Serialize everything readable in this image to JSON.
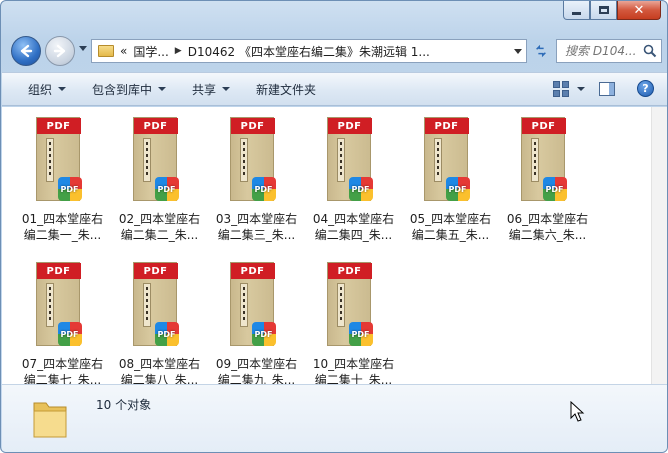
{
  "window": {
    "caption": {
      "minimize": "minimize",
      "maximize": "maximize",
      "close": "✕"
    }
  },
  "nav": {
    "breadcrumb": [
      "国学...",
      "D10462 《四本堂座右编二集》朱潮远辑 1..."
    ],
    "overflow": "«",
    "search_placeholder": "搜索 D104..."
  },
  "toolbar": {
    "organize": "组织",
    "include_in_library": "包含到库中",
    "share": "共享",
    "new_folder": "新建文件夹"
  },
  "files": [
    {
      "line1": "01_四本堂座右",
      "line2": "编二集一_朱..."
    },
    {
      "line1": "02_四本堂座右",
      "line2": "编二集二_朱..."
    },
    {
      "line1": "03_四本堂座右",
      "line2": "编二集三_朱..."
    },
    {
      "line1": "04_四本堂座右",
      "line2": "编二集四_朱..."
    },
    {
      "line1": "05_四本堂座右",
      "line2": "编二集五_朱..."
    },
    {
      "line1": "06_四本堂座右",
      "line2": "编二集六_朱..."
    },
    {
      "line1": "07_四本堂座右",
      "line2": "编二集七_朱..."
    },
    {
      "line1": "08_四本堂座右",
      "line2": "编二集八_朱..."
    },
    {
      "line1": "09_四本堂座右",
      "line2": "编二集九_朱..."
    },
    {
      "line1": "10_四本堂座右",
      "line2": "编二集十_朱..."
    }
  ],
  "pdf_label": "PDF",
  "status": {
    "count": "10 个对象"
  },
  "colors": {
    "pdf_red": "#d01e24",
    "chrome_blue": "#bcd3ea"
  }
}
